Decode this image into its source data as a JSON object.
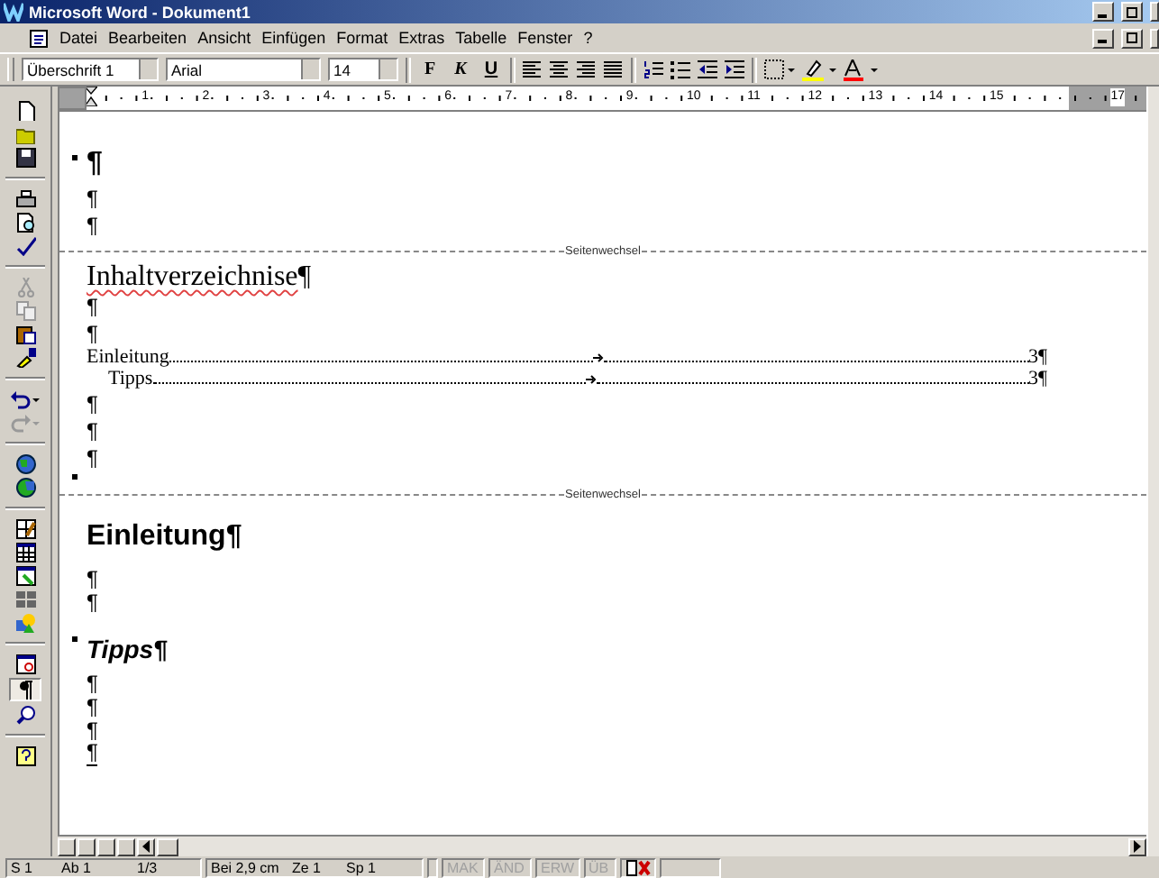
{
  "window": {
    "title": "Microsoft Word - Dokument1"
  },
  "menu": [
    "Datei",
    "Bearbeiten",
    "Ansicht",
    "Einfügen",
    "Format",
    "Extras",
    "Tabelle",
    "Fenster",
    "?"
  ],
  "format_toolbar": {
    "style": "Überschrift 1",
    "font": "Arial",
    "size": "14",
    "buttons": [
      {
        "label": "F",
        "kind": "bold"
      },
      {
        "label": "K",
        "kind": "italic"
      },
      {
        "label": "U",
        "kind": "underline"
      }
    ]
  },
  "side_toolbar": {
    "show_marks": true
  },
  "ruler": [
    "1",
    "2",
    "3",
    "4",
    "5",
    "6",
    "7",
    "8",
    "9",
    "10",
    "11",
    "12",
    "13",
    "14",
    "15",
    "17"
  ],
  "document": [
    {
      "kind": "heading-empty",
      "text": "¶"
    },
    {
      "kind": "para",
      "text": "¶"
    },
    {
      "kind": "para",
      "text": "¶"
    },
    {
      "kind": "page-break",
      "text": "Seitenwechsel"
    },
    {
      "kind": "toc-title",
      "text": "Inhaltverzeichnise",
      "mark": "¶",
      "misspelled": true
    },
    {
      "kind": "para",
      "text": "¶"
    },
    {
      "kind": "para",
      "text": "¶"
    },
    {
      "kind": "toc-entry",
      "text": "Einleitung",
      "page": "3¶",
      "children": [
        {
          "kind": "toc-entry",
          "text": "Tipps",
          "page": "3¶"
        }
      ]
    },
    {
      "kind": "para",
      "text": "¶"
    },
    {
      "kind": "para",
      "text": "¶"
    },
    {
      "kind": "para",
      "text": "¶"
    },
    {
      "kind": "section-mark"
    },
    {
      "kind": "page-break",
      "text": "Seitenwechsel"
    },
    {
      "kind": "heading1",
      "text": "Einleitung¶"
    },
    {
      "kind": "para",
      "text": "¶"
    },
    {
      "kind": "para",
      "text": "¶"
    },
    {
      "kind": "heading2",
      "text": "Tipps¶"
    },
    {
      "kind": "para",
      "text": "¶"
    },
    {
      "kind": "para",
      "text": "¶"
    },
    {
      "kind": "para",
      "text": "¶"
    },
    {
      "kind": "para",
      "text": "¶"
    }
  ],
  "status_bar": [
    {
      "text": "S 1",
      "disabled": false
    },
    {
      "text": "Ab 1",
      "disabled": false
    },
    {
      "text": "1/3",
      "disabled": false
    },
    {
      "text": "Bei 2,9 cm",
      "disabled": false
    },
    {
      "text": "Ze 1",
      "disabled": false
    },
    {
      "text": "Sp 1",
      "disabled": false
    },
    {
      "text": "MAK",
      "disabled": true
    },
    {
      "text": "ÄND",
      "disabled": true
    },
    {
      "text": "ERW",
      "disabled": true
    },
    {
      "text": "ÜB",
      "disabled": true
    }
  ]
}
